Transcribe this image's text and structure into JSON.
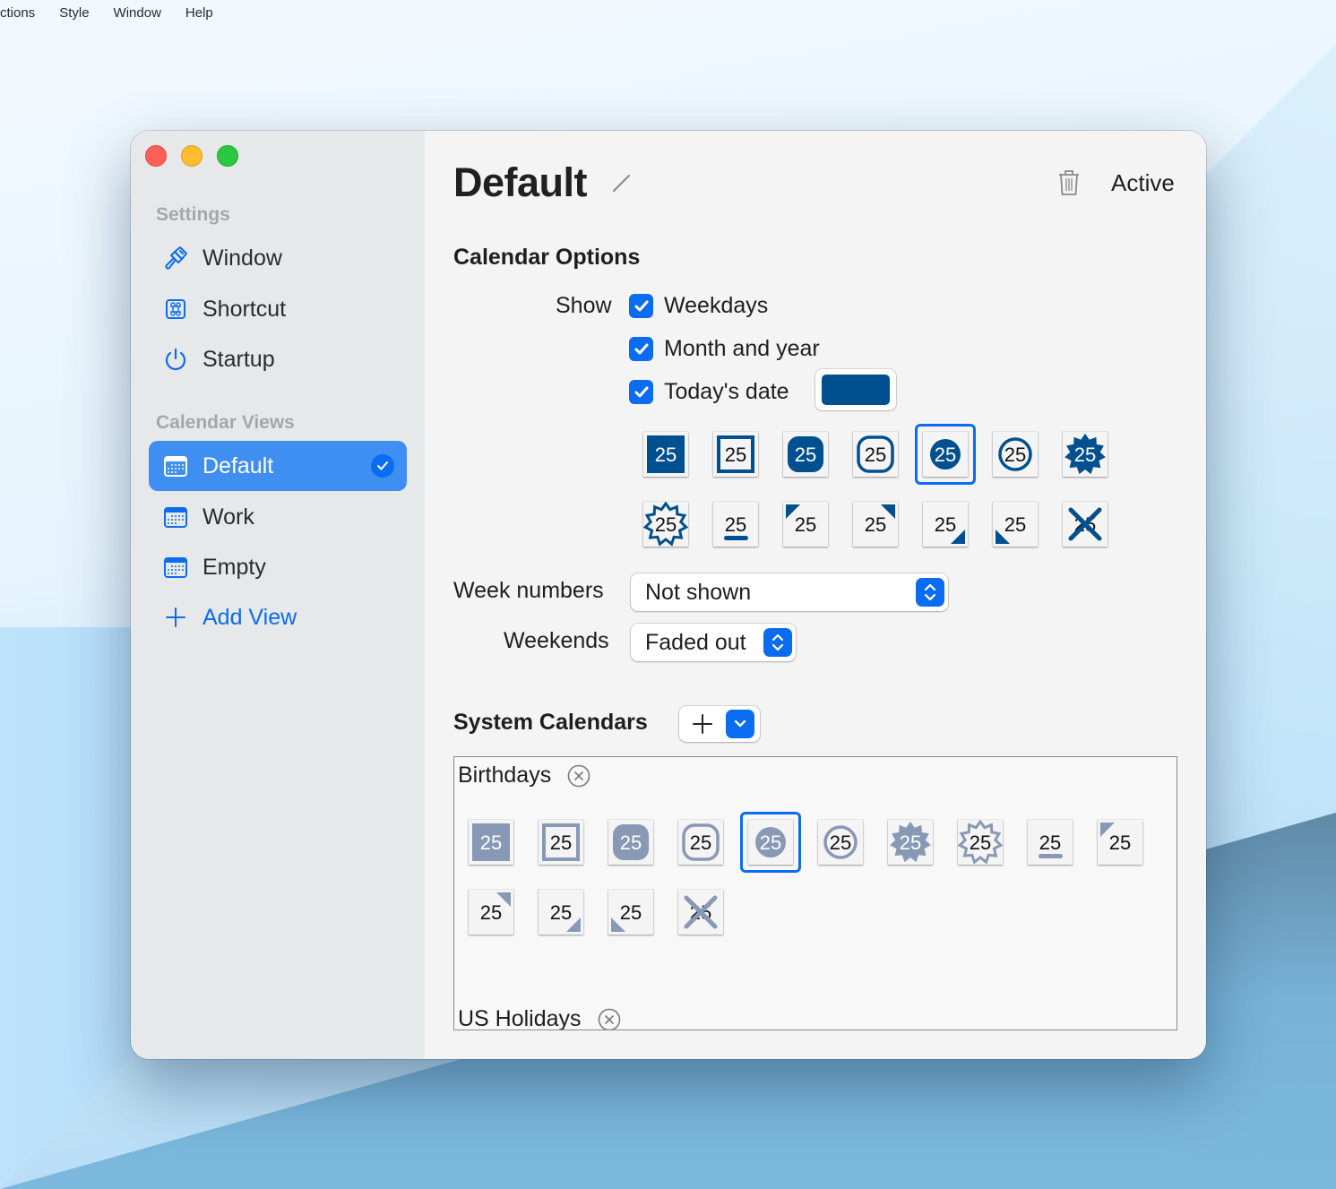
{
  "menubar": {
    "items": [
      "ctions",
      "Style",
      "Window",
      "Help"
    ]
  },
  "sidebar": {
    "settings_header": "Settings",
    "settings_items": [
      {
        "label": "Window",
        "icon": "paintbrush-icon"
      },
      {
        "label": "Shortcut",
        "icon": "command-key-icon"
      },
      {
        "label": "Startup",
        "icon": "power-icon"
      }
    ],
    "views_header": "Calendar Views",
    "views": [
      {
        "label": "Default",
        "icon": "calendar-icon",
        "selected": true,
        "active": true
      },
      {
        "label": "Work",
        "icon": "calendar-icon",
        "selected": false
      },
      {
        "label": "Empty",
        "icon": "calendar-icon",
        "selected": false
      }
    ],
    "add_view_label": "Add View"
  },
  "header": {
    "title": "Default",
    "active_label": "Active"
  },
  "calendar_options": {
    "heading": "Calendar Options",
    "show_label": "Show",
    "checkboxes": [
      {
        "label": "Weekdays",
        "checked": true
      },
      {
        "label": "Month and year",
        "checked": true
      },
      {
        "label": "Today's date",
        "checked": true
      }
    ],
    "today_color": "#00508f",
    "today_styles": [
      "filled-square",
      "outlined-square",
      "filled-rounded",
      "outlined-rounded",
      "filled-circle",
      "outlined-circle",
      "filled-star",
      "outlined-star",
      "underline",
      "corner-top-left",
      "corner-top-right",
      "corner-bottom-right",
      "corner-bottom-left",
      "cross"
    ],
    "selected_style": "filled-circle",
    "day_number": "25",
    "week_numbers_label": "Week numbers",
    "week_numbers_value": "Not shown",
    "weekends_label": "Weekends",
    "weekends_value": "Faded out"
  },
  "system_calendars": {
    "heading": "System Calendars",
    "calendars": [
      {
        "name": "Birthdays",
        "color": "#8799b4",
        "styles": [
          "filled-square",
          "outlined-square",
          "filled-rounded",
          "outlined-rounded",
          "filled-circle",
          "outlined-circle",
          "filled-star",
          "outlined-star",
          "underline",
          "corner-top-left",
          "corner-top-right",
          "corner-bottom-right",
          "corner-bottom-left",
          "cross"
        ],
        "selected_style": "filled-circle"
      },
      {
        "name": "US Holidays"
      }
    ]
  },
  "colors": {
    "accent": "#0a6cf0",
    "selected_row": "#3f8ef2"
  }
}
